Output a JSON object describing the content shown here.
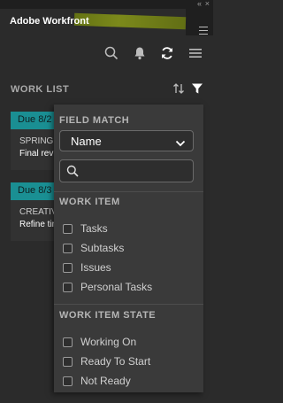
{
  "panel": {
    "title": "Adobe Workfront",
    "collapse_glyph": "«",
    "close_glyph": "×"
  },
  "icons": {
    "search": "search-icon",
    "bell": "bell-icon",
    "refresh": "refresh-icon",
    "menu": "hamburger-menu-icon",
    "sort": "sort-icon",
    "filter": "filter-icon"
  },
  "worklist": {
    "title": "WORK LIST",
    "cards": [
      {
        "due": "Due 8/2",
        "project": "SPRING C",
        "task": "Final revi"
      },
      {
        "due": "Due 8/3",
        "project": "CREATIVE",
        "task": "Refine tim"
      }
    ]
  },
  "filter": {
    "field_match_title": "FIELD MATCH",
    "field_match_value": "Name",
    "search_value": "",
    "work_item_title": "WORK ITEM",
    "work_items": [
      "Tasks",
      "Subtasks",
      "Issues",
      "Personal Tasks"
    ],
    "work_item_state_title": "WORK ITEM STATE",
    "states": [
      "Working On",
      "Ready To Start",
      "Not Ready"
    ]
  },
  "colors": {
    "accent_teal": "#1a8f93",
    "background": "#2b2b2b",
    "panel": "#3a3a3a"
  }
}
